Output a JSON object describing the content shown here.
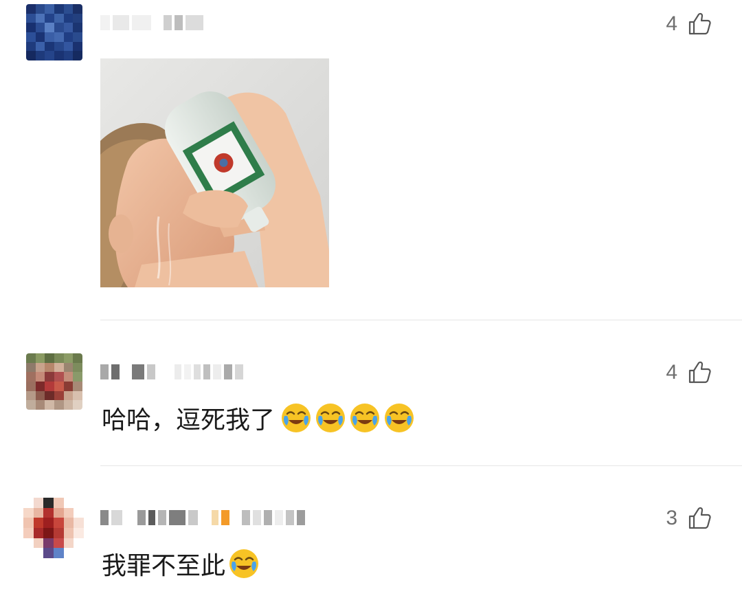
{
  "comments": [
    {
      "likes": "4",
      "text": "",
      "has_photo": true
    },
    {
      "likes": "4",
      "text": "哈哈，逗死我了",
      "emoji_count": 4
    },
    {
      "likes": "3",
      "text": "我罪不至此",
      "emoji_count": 1
    }
  ],
  "icons": {
    "like": "thumbs-up-icon",
    "emoji": "laughing-crying-emoji"
  },
  "colors": {
    "text": "#1a1a1a",
    "meta": "#6e6e6e",
    "divider": "#e6e6e6",
    "emoji_face": "#f7c325"
  }
}
